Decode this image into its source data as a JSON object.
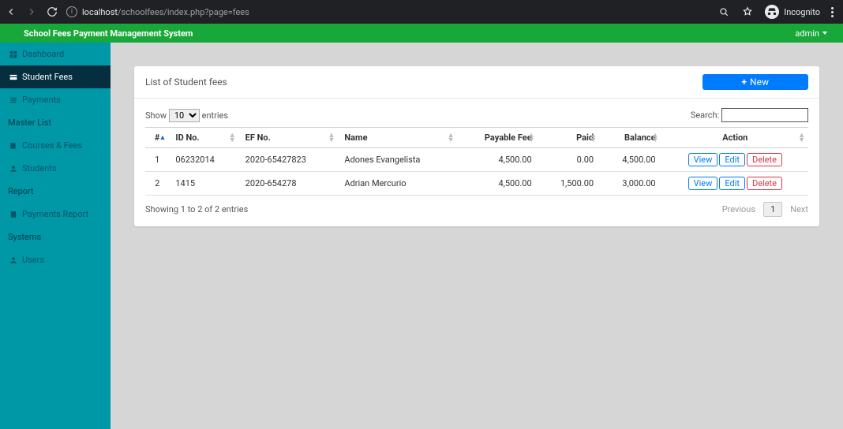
{
  "chrome": {
    "host": "localhost",
    "path": "/schoolfees/index.php?page=fees",
    "incognito": "Incognito"
  },
  "appbar": {
    "title": "School Fees Payment Management System",
    "user": "admin"
  },
  "sidebar": {
    "items": [
      {
        "label": "Dashboard",
        "active": false
      },
      {
        "label": "Student Fees",
        "active": true
      },
      {
        "label": "Payments",
        "active": false
      }
    ],
    "sections": {
      "master": {
        "title": "Master List",
        "items": [
          {
            "label": "Courses & Fees"
          },
          {
            "label": "Students"
          }
        ]
      },
      "report": {
        "title": "Report",
        "items": [
          {
            "label": "Payments Report"
          }
        ]
      },
      "systems": {
        "title": "Systems",
        "items": [
          {
            "label": "Users"
          }
        ]
      }
    }
  },
  "card": {
    "title": "List of Student fees",
    "new": "New",
    "show_pre": "Show",
    "show_post": "entries",
    "show_val": "10",
    "search_label": "Search:",
    "cols": {
      "idx": "#",
      "idno": "ID No.",
      "efno": "EF No.",
      "name": "Name",
      "fee": "Payable Fee",
      "paid": "Paid",
      "bal": "Balance",
      "action": "Action"
    },
    "rows": [
      {
        "idx": "1",
        "idno": "06232014",
        "efno": "2020-65427823",
        "name": "Adones Evangelista",
        "fee": "4,500.00",
        "paid": "0.00",
        "bal": "4,500.00"
      },
      {
        "idx": "2",
        "idno": "1415",
        "efno": "2020-654278",
        "name": "Adrian Mercurio",
        "fee": "4,500.00",
        "paid": "1,500.00",
        "bal": "3,000.00"
      }
    ],
    "actions": {
      "view": "View",
      "edit": "Edit",
      "del": "Delete"
    },
    "info": "Showing 1 to 2 of 2 entries",
    "pager": {
      "prev": "Previous",
      "page": "1",
      "next": "Next"
    }
  }
}
